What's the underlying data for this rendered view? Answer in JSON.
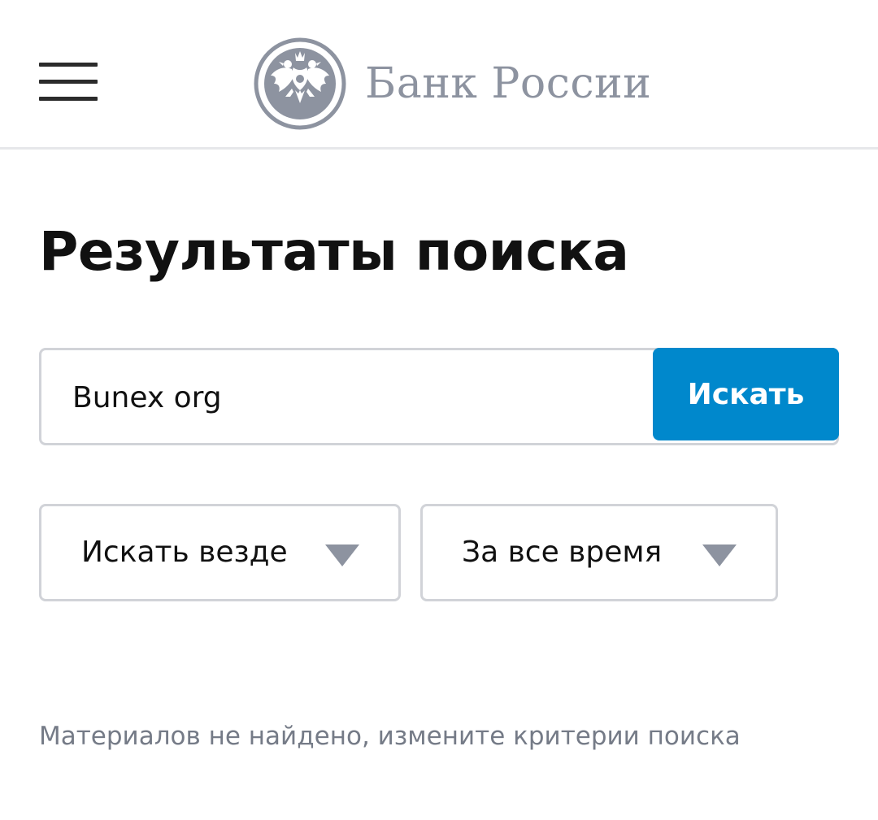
{
  "header": {
    "menu_icon": "hamburger-menu-icon",
    "logo_icon": "double-headed-eagle-emblem",
    "logo_text": "Банк России"
  },
  "main": {
    "title": "Результаты поиска",
    "search": {
      "value": "Bunex org",
      "button_label": "Искать"
    },
    "filters": {
      "where": {
        "selected": "Искать везде",
        "icon": "triangle-down-icon"
      },
      "period": {
        "selected": "За все время",
        "icon": "triangle-down-icon"
      }
    },
    "empty_message": "Материалов не найдено, измените критерии поиска"
  },
  "colors": {
    "accent": "#0088cc",
    "logo_gray": "#8d93a0",
    "border": "#d1d3d8",
    "muted_text": "#757b87"
  }
}
